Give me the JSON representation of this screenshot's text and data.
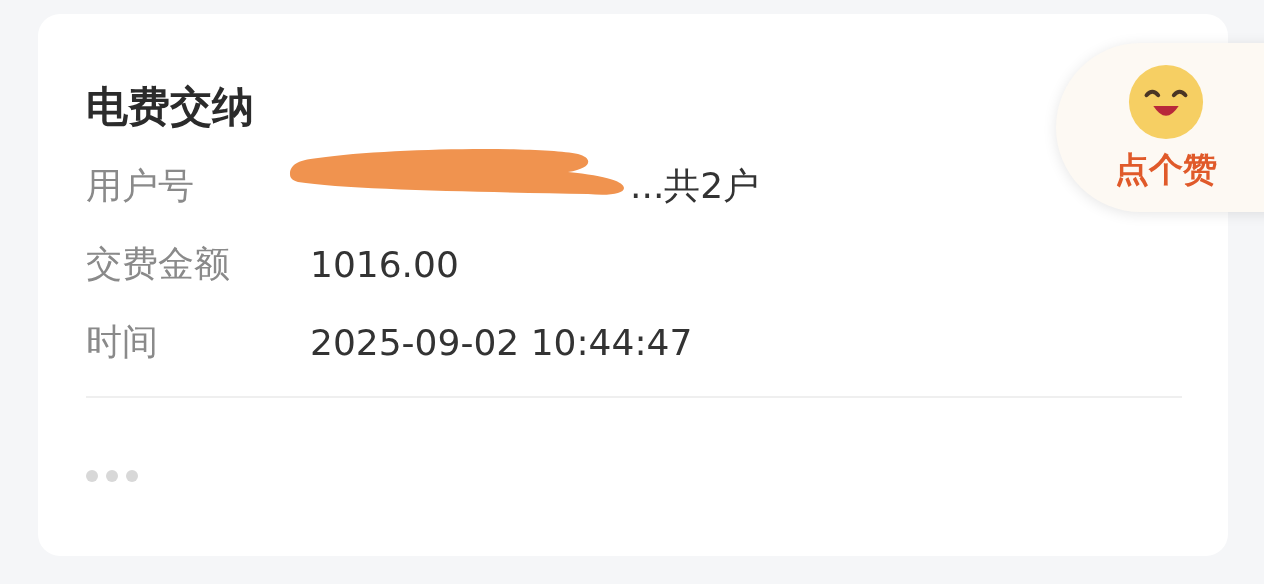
{
  "card": {
    "title": "电费交纳",
    "fields": [
      {
        "label": "用户号",
        "value": "...共2户",
        "kind": "redacted"
      },
      {
        "label": "交费金额",
        "value": "1016.00",
        "kind": "plain"
      },
      {
        "label": "时间",
        "value": "2025-09-02 10:44:47",
        "kind": "plain"
      }
    ]
  },
  "like_button": {
    "label": "点个赞"
  }
}
